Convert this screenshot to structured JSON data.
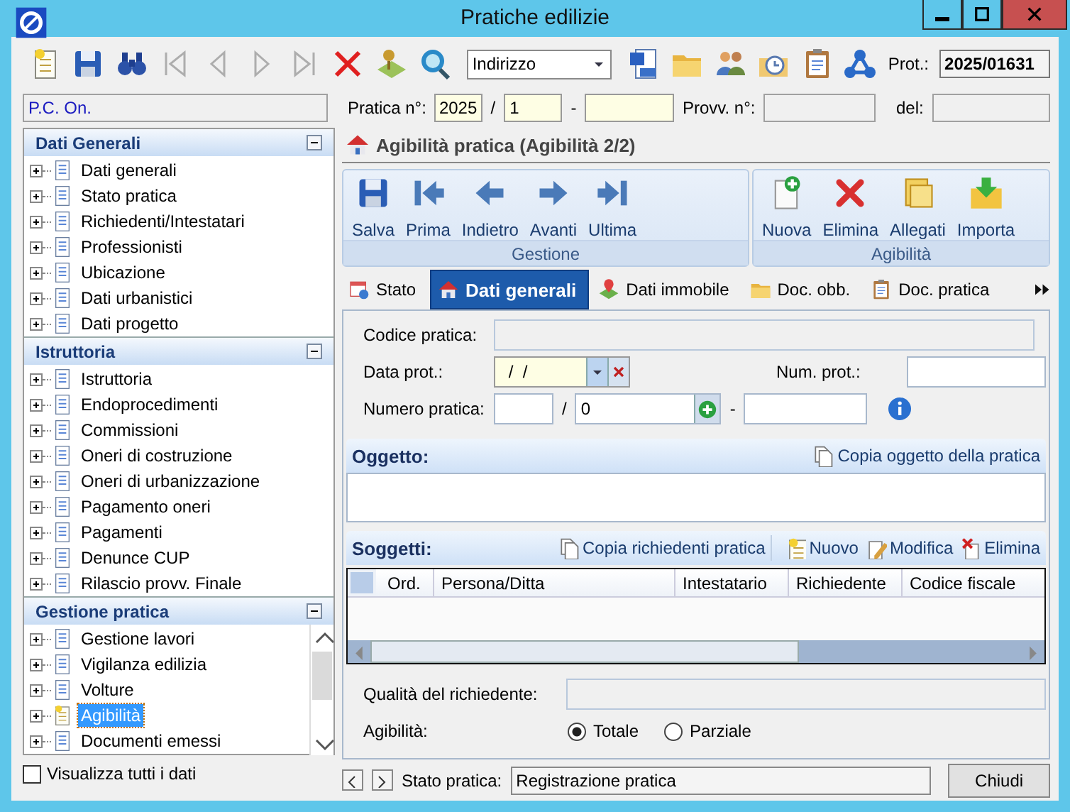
{
  "window": {
    "title": "Pratiche edilizie"
  },
  "toolbar": {
    "tools": [
      {
        "kind": "new",
        "disabled": false
      },
      {
        "kind": "save",
        "disabled": false
      },
      {
        "kind": "find",
        "disabled": false
      },
      {
        "kind": "first",
        "disabled": true
      },
      {
        "kind": "prev",
        "disabled": true
      },
      {
        "kind": "next",
        "disabled": true
      },
      {
        "kind": "last",
        "disabled": true
      },
      {
        "kind": "delete",
        "disabled": false
      },
      {
        "kind": "map",
        "disabled": false
      },
      {
        "kind": "zoom",
        "disabled": false
      }
    ],
    "search_combo": {
      "value": "Indirizzo"
    },
    "tools_right": [
      {
        "kind": "worddoc",
        "disabled": false
      },
      {
        "kind": "folder",
        "disabled": false
      },
      {
        "kind": "people",
        "disabled": false
      },
      {
        "kind": "clockfolder",
        "disabled": false
      },
      {
        "kind": "clipboard",
        "disabled": false
      },
      {
        "kind": "network",
        "disabled": false
      }
    ],
    "prot_label": "Prot.:",
    "prot_value": "2025/01631"
  },
  "header_row": {
    "office": "P.C. On.",
    "pratica_label": "Pratica n°:",
    "year": "2025",
    "sep1": "/",
    "number": "1",
    "sep2": "-",
    "provv_label": "Provv. n°:",
    "del_label": "del:"
  },
  "sidebar": {
    "groups": [
      {
        "title": "Dati Generali",
        "expanded": true,
        "items": [
          {
            "label": "Dati generali",
            "selected": false
          },
          {
            "label": "Stato pratica",
            "selected": false
          },
          {
            "label": "Richiedenti/Intestatari",
            "selected": false
          },
          {
            "label": "Professionisti",
            "selected": false
          },
          {
            "label": "Ubicazione",
            "selected": false
          },
          {
            "label": "Dati urbanistici",
            "selected": false
          },
          {
            "label": "Dati progetto",
            "selected": false
          }
        ]
      },
      {
        "title": "Istruttoria",
        "expanded": true,
        "items": [
          {
            "label": "Istruttoria",
            "selected": false
          },
          {
            "label": "Endoprocedimenti",
            "selected": false
          },
          {
            "label": "Commissioni",
            "selected": false
          },
          {
            "label": "Oneri di costruzione",
            "selected": false
          },
          {
            "label": "Oneri di urbanizzazione",
            "selected": false
          },
          {
            "label": "Pagamento oneri",
            "selected": false
          },
          {
            "label": "Pagamenti",
            "selected": false
          },
          {
            "label": "Denunce CUP",
            "selected": false
          },
          {
            "label": "Rilascio provv. Finale",
            "selected": false
          }
        ]
      },
      {
        "title": "Gestione pratica",
        "expanded": true,
        "items": [
          {
            "label": "Gestione lavori",
            "selected": false
          },
          {
            "label": "Vigilanza edilizia",
            "selected": false
          },
          {
            "label": "Volture",
            "selected": false
          },
          {
            "label": "Agibilità",
            "selected": true
          },
          {
            "label": "Documenti emessi",
            "selected": false
          }
        ]
      }
    ],
    "show_all": {
      "label": "Visualizza tutti i dati",
      "checked": false
    }
  },
  "panel": {
    "title": "Agibilità pratica (Agibilità 2/2)",
    "ribbon_groups": [
      {
        "title": "Gestione",
        "buttons": [
          {
            "kind": "save",
            "label": "Salva"
          },
          {
            "kind": "first",
            "label": "Prima"
          },
          {
            "kind": "prev",
            "label": "Indietro"
          },
          {
            "kind": "next",
            "label": "Avanti"
          },
          {
            "kind": "last",
            "label": "Ultima"
          }
        ]
      },
      {
        "title": "Agibilità",
        "buttons": [
          {
            "kind": "new",
            "label": "Nuova"
          },
          {
            "kind": "delete",
            "label": "Elimina"
          },
          {
            "kind": "attach",
            "label": "Allegati"
          },
          {
            "kind": "import",
            "label": "Importa"
          }
        ]
      }
    ],
    "tabs": [
      {
        "kind": "calendar",
        "label": "Stato",
        "selected": false
      },
      {
        "kind": "house",
        "label": "Dati generali",
        "selected": true
      },
      {
        "kind": "pin",
        "label": "Dati immobile",
        "selected": false
      },
      {
        "kind": "folder",
        "label": "Doc. obb.",
        "selected": false
      },
      {
        "kind": "clipboard",
        "label": "Doc. pratica",
        "selected": false
      }
    ],
    "form": {
      "codice_label": "Codice pratica:",
      "data_prot_label": "Data prot.:",
      "data_prot_value": " /  /",
      "num_prot_label": "Num. prot.:",
      "numero_label": "Numero pratica:",
      "numero_sep1": "/",
      "numero_value": "0",
      "numero_sep2": "-"
    },
    "oggetto": {
      "title": "Oggetto:",
      "action": "Copia oggetto della pratica"
    },
    "soggetti": {
      "title": "Soggetti:",
      "actions": [
        {
          "kind": "copy",
          "label": "Copia richiedenti pratica"
        },
        {
          "kind": "new",
          "label": "Nuovo"
        },
        {
          "kind": "edit",
          "label": "Modifica"
        },
        {
          "kind": "delete",
          "label": "Elimina"
        }
      ],
      "columns": [
        "Ord.",
        "Persona/Ditta",
        "Intestatario",
        "Richiedente",
        "Codice fiscale"
      ]
    },
    "qualita_label": "Qualità del richiedente:",
    "agibilita": {
      "label": "Agibilità:",
      "options": [
        {
          "label": "Totale",
          "selected": true
        },
        {
          "label": "Parziale",
          "selected": false
        }
      ]
    }
  },
  "footer": {
    "stato_label": "Stato pratica:",
    "stato_value": "Registrazione pratica",
    "close_button": "Chiudi"
  }
}
